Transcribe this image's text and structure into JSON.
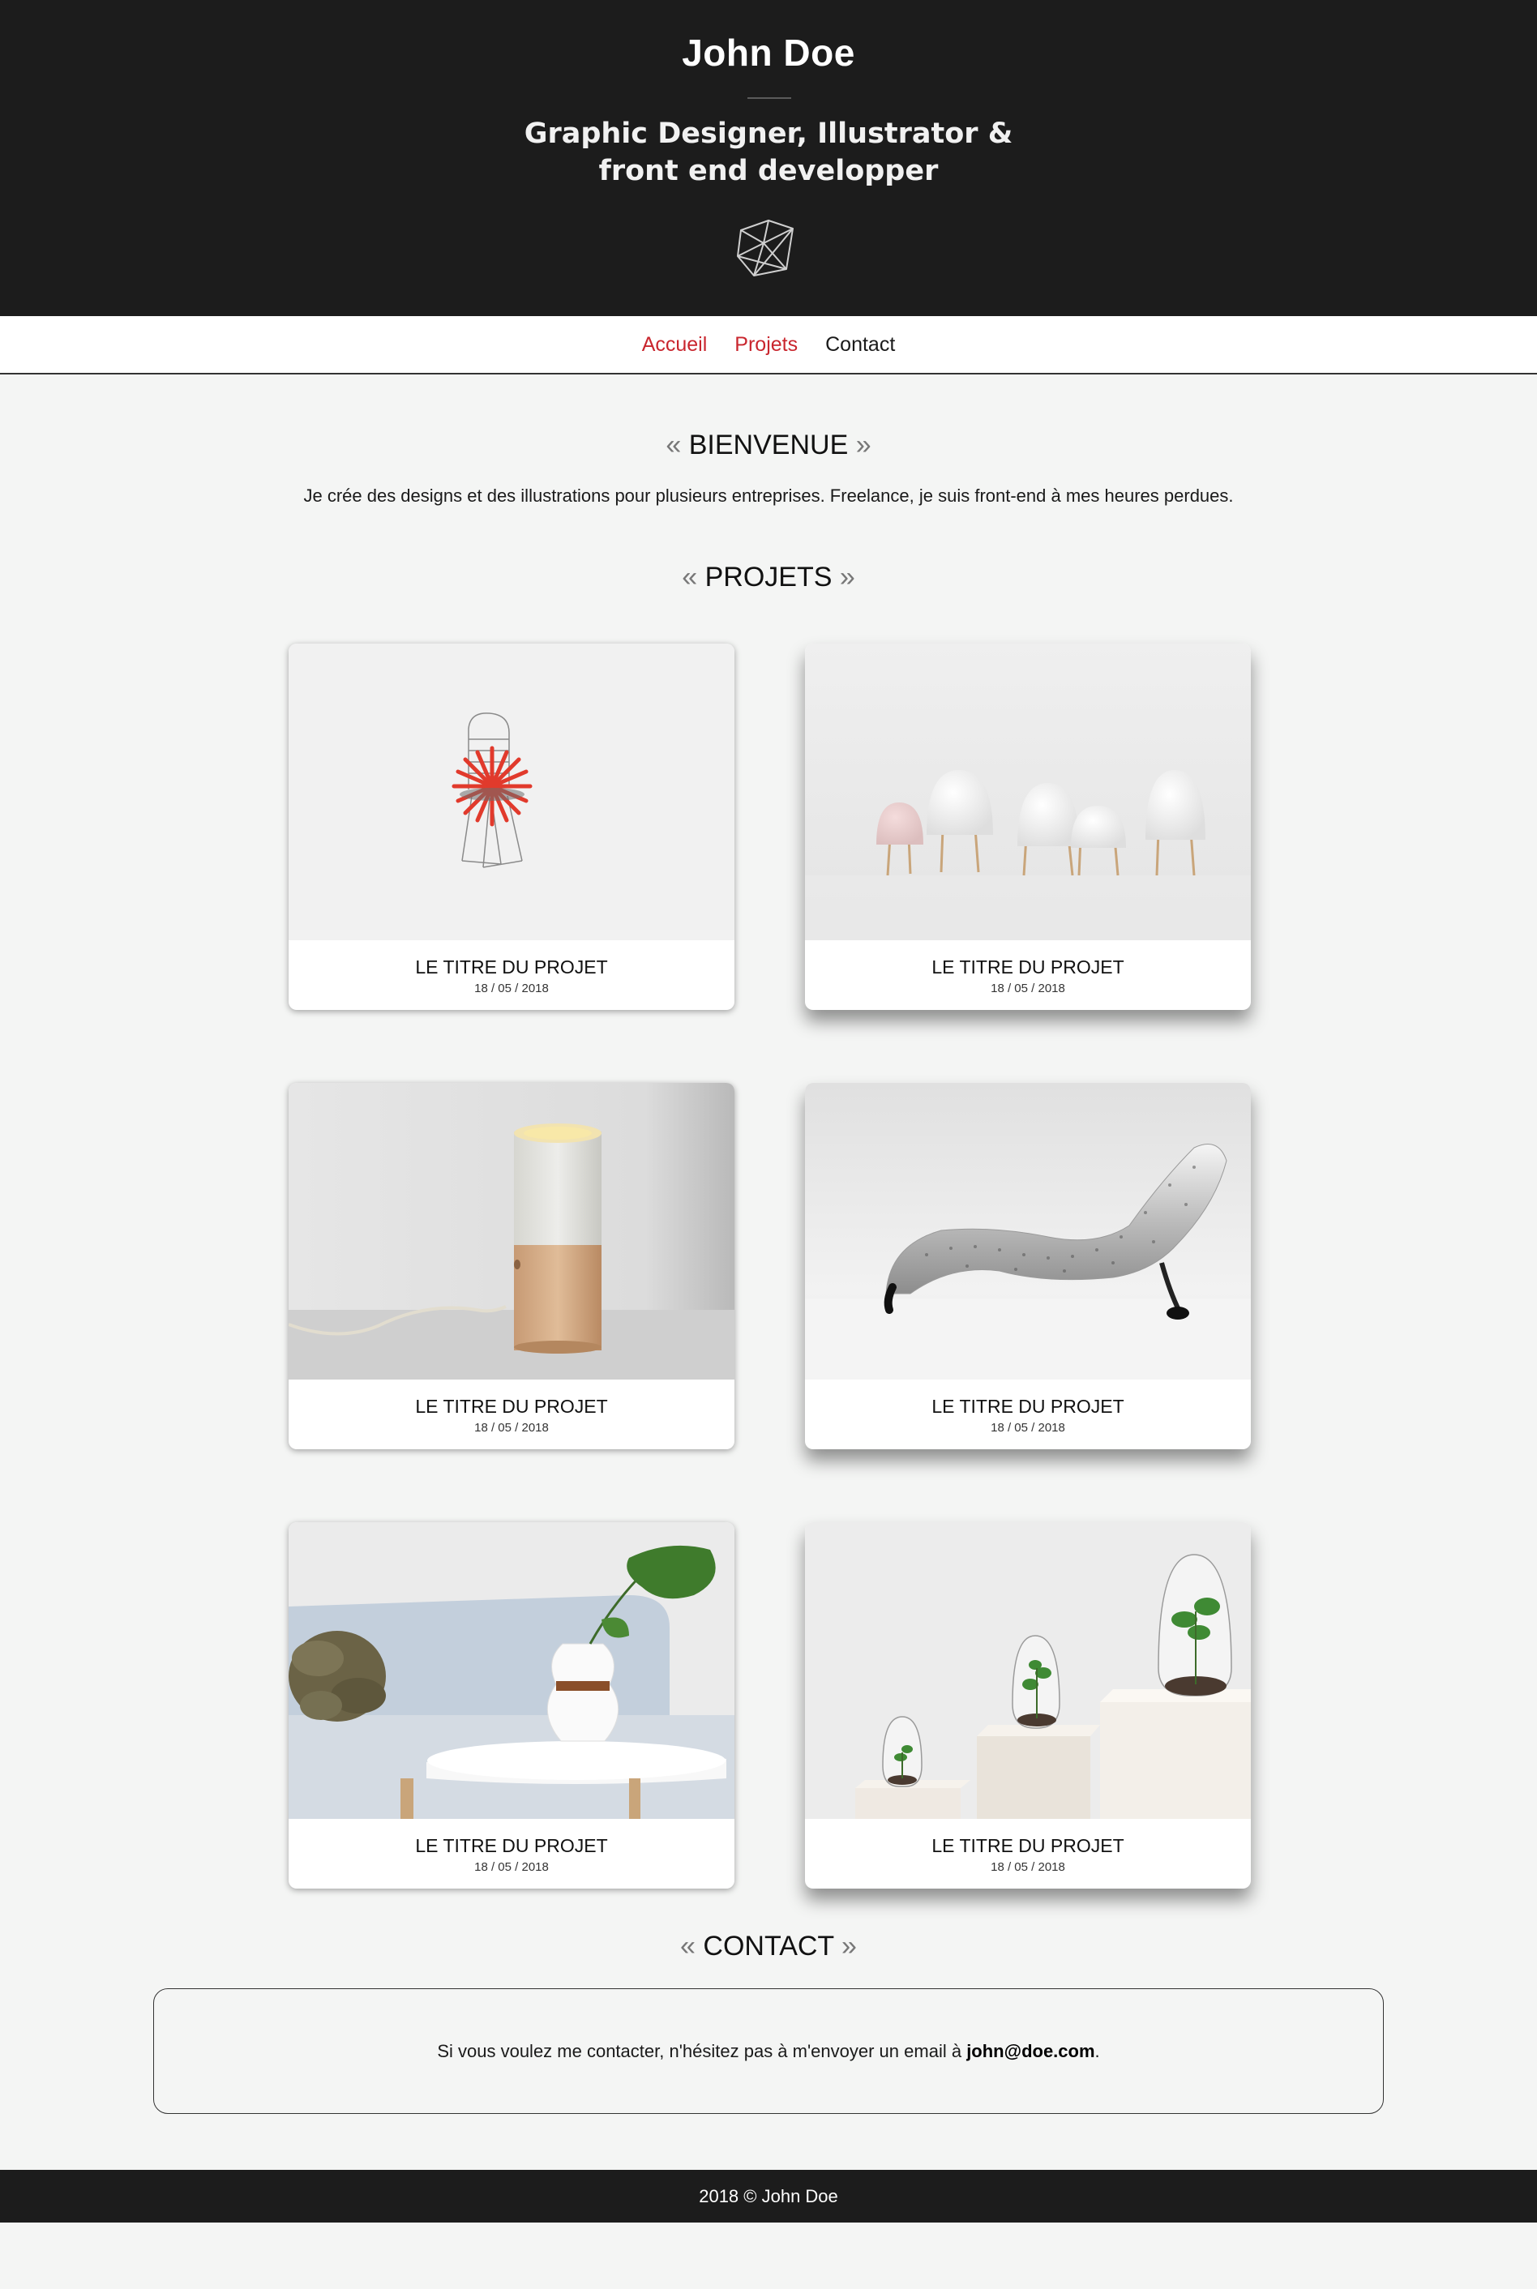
{
  "header": {
    "name": "John Doe",
    "subtitle_line1": "Graphic Designer, Illustrator &",
    "subtitle_line2": "front end developper",
    "logo_icon": "polyhedron-logo-icon"
  },
  "nav": {
    "items": [
      {
        "label": "Accueil",
        "color": "#c9262e"
      },
      {
        "label": "Projets",
        "color": "#c9262e"
      },
      {
        "label": "Contact",
        "color": "#1a1a1a"
      }
    ]
  },
  "welcome": {
    "quote_open": "«",
    "quote_close": "»",
    "title": "BIENVENUE",
    "text": "Je crée des designs et des illustrations pour plusieurs entreprises. Freelance, je suis front-end à mes heures perdues."
  },
  "projects": {
    "title": "PROJETS",
    "items": [
      {
        "title": "LE TITRE DU PROJET",
        "date": "18 / 05 / 2018",
        "image": "red-wire-chair"
      },
      {
        "title": "LE TITRE DU PROJET",
        "date": "18 / 05 / 2018",
        "image": "white-dome-chairs"
      },
      {
        "title": "LE TITRE DU PROJET",
        "date": "18 / 05 / 2018",
        "image": "wooden-lamp"
      },
      {
        "title": "LE TITRE DU PROJET",
        "date": "18 / 05 / 2018",
        "image": "metal-chaise-longue"
      },
      {
        "title": "LE TITRE DU PROJET",
        "date": "18 / 05 / 2018",
        "image": "vase-monstera-sofa"
      },
      {
        "title": "LE TITRE DU PROJET",
        "date": "18 / 05 / 2018",
        "image": "glass-terrariums"
      }
    ]
  },
  "contact": {
    "title": "CONTACT",
    "text_before": "Si vous voulez me contacter, n'hésitez pas à m'envoyer un email à ",
    "email": "john@doe.com",
    "text_after": "."
  },
  "footer": {
    "text": "2018 © John Doe"
  },
  "colors": {
    "header_bg": "#1c1c1c",
    "page_bg": "#f4f5f4",
    "nav_active": "#c9262e"
  }
}
